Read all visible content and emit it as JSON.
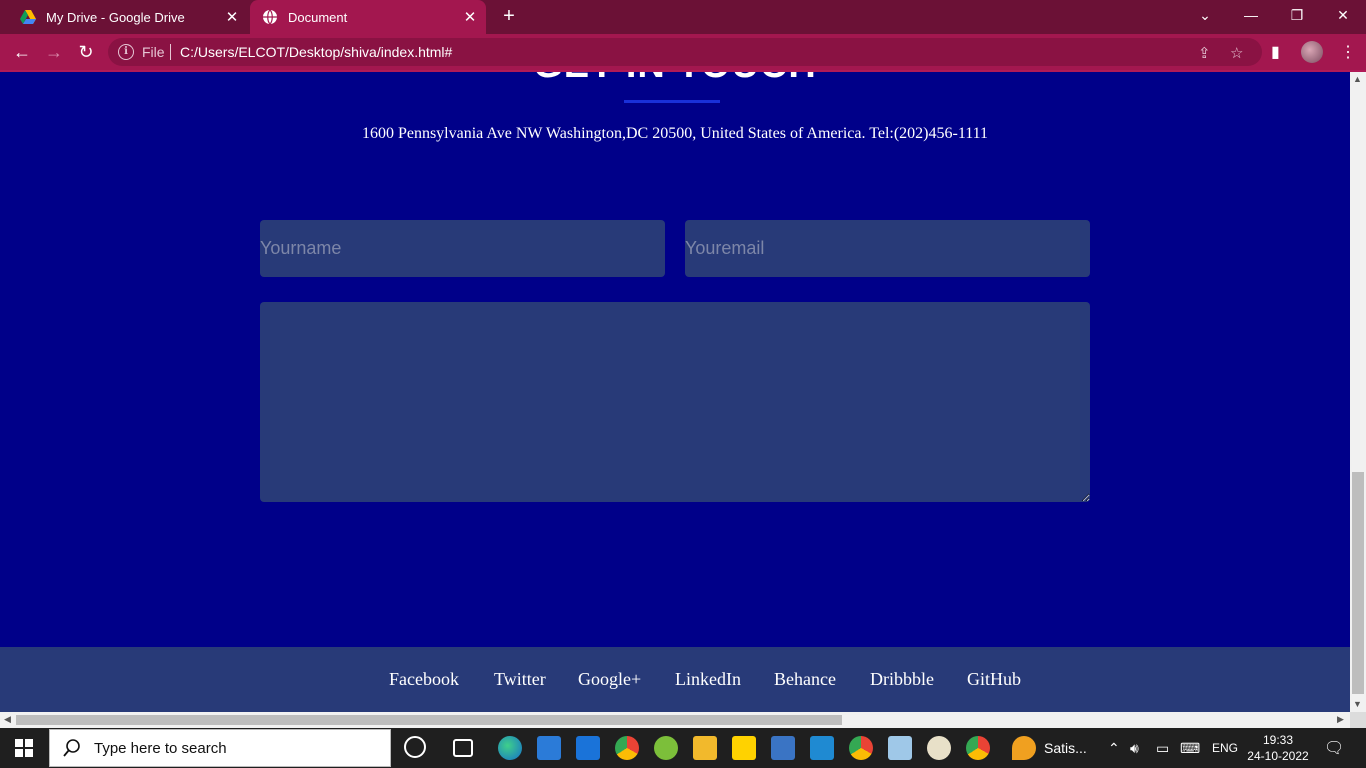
{
  "browser": {
    "tabs": [
      {
        "title": "My Drive - Google Drive",
        "active": false
      },
      {
        "title": "Document",
        "active": true
      }
    ],
    "address": {
      "scheme_label": "File",
      "url": "C:/Users/ELCOT/Desktop/shiva/index.html#"
    }
  },
  "page": {
    "heading": "GET IN TOUCH",
    "address_line": "1600 Pennsylvania Ave NW Washington,DC 20500, United States of America. Tel:(202)456-1111",
    "form": {
      "name_placeholder": "Yourname",
      "email_placeholder": "Youremail",
      "message_placeholder": ""
    },
    "footer_links": [
      "Facebook",
      "Twitter",
      "Google+",
      "LinkedIn",
      "Behance",
      "Dribbble",
      "GitHub"
    ]
  },
  "taskbar": {
    "search_placeholder": "Type here to search",
    "pinned_app_label": "Satis...",
    "language": "ENG",
    "time": "19:33",
    "date": "24-10-2022"
  },
  "colors": {
    "tab_strip": "#6b1136",
    "toolbar": "#a3174f",
    "page_bg": "#000089",
    "field_bg": "#283a78",
    "footer_bg": "#283a78",
    "heading_underline": "#1930d9"
  }
}
